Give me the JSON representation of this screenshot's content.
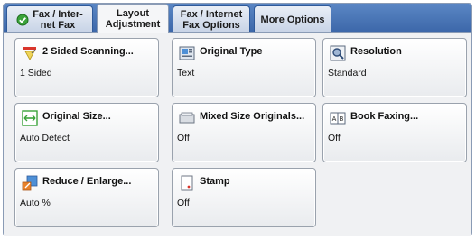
{
  "tabs": [
    {
      "label": "Fax / Inter-\nnet Fax"
    },
    {
      "label": "Layout\nAdjustment"
    },
    {
      "label": "Fax / Internet\nFax Options"
    },
    {
      "label": "More Options"
    }
  ],
  "active_tab": "Layout\nAdjustment",
  "buttons": [
    {
      "title": "2 Sided Scanning...",
      "value": "1 Sided",
      "icon": "two-sided-scanning-icon"
    },
    {
      "title": "Original Type",
      "value": "Text",
      "icon": "original-type-icon"
    },
    {
      "title": "Resolution",
      "value": "Standard",
      "icon": "resolution-icon"
    },
    {
      "title": "Original Size...",
      "value": "Auto Detect",
      "icon": "original-size-icon"
    },
    {
      "title": "Mixed Size Originals...",
      "value": "Off",
      "icon": "mixed-size-originals-icon"
    },
    {
      "title": "Book Faxing...",
      "value": "Off",
      "icon": "book-faxing-icon"
    },
    {
      "title": "Reduce / Enlarge...",
      "value": "Auto %",
      "icon": "reduce-enlarge-icon"
    },
    {
      "title": "Stamp",
      "value": "Off",
      "icon": "stamp-icon"
    }
  ],
  "colors": {
    "tabbar": "#3c67a9",
    "accent_green": "#3aa33a",
    "accent_orange": "#e8812a"
  }
}
